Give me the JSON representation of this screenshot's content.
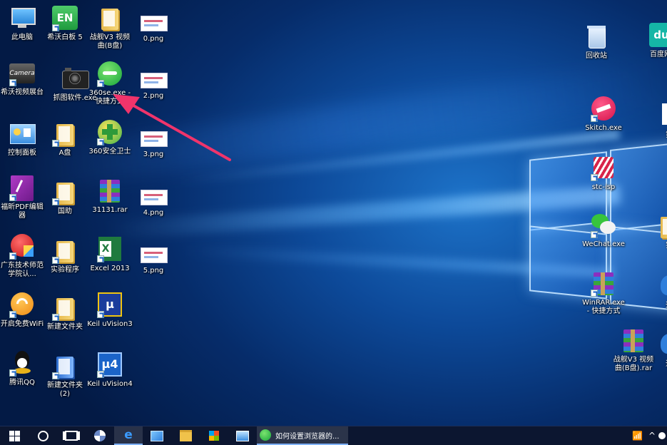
{
  "desktop": {
    "icons": [
      {
        "label": "此电脑",
        "icon": "this-pc-icon"
      },
      {
        "label": "希沃白板 5",
        "icon": "en-whiteboard-icon"
      },
      {
        "label": "战舰V3 视频曲(B盘)",
        "icon": "folder-icon"
      },
      {
        "label": "0.png",
        "icon": "image-file-icon"
      },
      {
        "label": "希沃视频展台",
        "icon": "camera-app-icon"
      },
      {
        "label": "抓图软件.exe",
        "icon": "screenshot-camera-icon"
      },
      {
        "label": "360se.exe - 快捷方式",
        "icon": "360-browser-icon"
      },
      {
        "label": "2.png",
        "icon": "image-file-icon"
      },
      {
        "label": "控制面板",
        "icon": "control-panel-icon"
      },
      {
        "label": "A盘",
        "icon": "folder-icon"
      },
      {
        "label": "360安全卫士",
        "icon": "360-security-icon"
      },
      {
        "label": "3.png",
        "icon": "image-file-icon"
      },
      {
        "label": "福昕PDF编辑器",
        "icon": "pdf-editor-icon"
      },
      {
        "label": "国助",
        "icon": "folder-icon"
      },
      {
        "label": "31131.rar",
        "icon": "rar-archive-icon"
      },
      {
        "label": "4.png",
        "icon": "image-file-icon"
      },
      {
        "label": "广东技术师范学院认...",
        "icon": "campus-auth-icon"
      },
      {
        "label": "实验程序",
        "icon": "folder-icon"
      },
      {
        "label": "Excel 2013",
        "icon": "excel-icon"
      },
      {
        "label": "5.png",
        "icon": "image-file-icon"
      },
      {
        "label": "开启免费WiFi",
        "icon": "wifi-app-icon"
      },
      {
        "label": "新建文件夹",
        "icon": "folder-icon"
      },
      {
        "label": "Keil uVision3",
        "icon": "keil-icon"
      },
      {
        "label": "腾讯QQ",
        "icon": "qq-icon"
      },
      {
        "label": "新建文件夹 (2)",
        "icon": "folder-icon"
      },
      {
        "label": "Keil uVision4",
        "icon": "keil-icon"
      },
      {
        "label": "回收站",
        "icon": "recycle-bin-icon"
      },
      {
        "label": "百度网",
        "icon": "baidu-du-icon"
      },
      {
        "label": "Skitch.exe",
        "icon": "skitch-icon"
      },
      {
        "label": "第",
        "icon": "document-icon"
      },
      {
        "label": "stc-isp",
        "icon": "stc-isp-icon"
      },
      {
        "label": "WeChat.exe",
        "icon": "wechat-icon"
      },
      {
        "label": "实",
        "icon": "folder-icon"
      },
      {
        "label": "WinRAR.exe - 快捷方式",
        "icon": "winrar-icon"
      },
      {
        "label": "迅",
        "icon": "thunder-icon"
      },
      {
        "label": "战舰V3 视频曲(B盘).rar",
        "icon": "rar-archive-icon"
      },
      {
        "label": "迅",
        "icon": "thunder-icon"
      }
    ]
  },
  "taskbar": {
    "start": "start-icon",
    "search": "search-circle-icon",
    "task_view": "task-view-icon",
    "pins": [
      "fan-app-icon",
      "edge-icon",
      "paint-icon",
      "file-explorer-icon",
      "store-icon",
      "photo-viewer-icon"
    ],
    "window_title": "如何设置浏览器的...",
    "tray": [
      "wifi-icon",
      "chevron-up-icon",
      "input-method-icon"
    ]
  },
  "colors": {
    "arrow": "#f0346b",
    "taskbar_bg": "#0c1630"
  }
}
